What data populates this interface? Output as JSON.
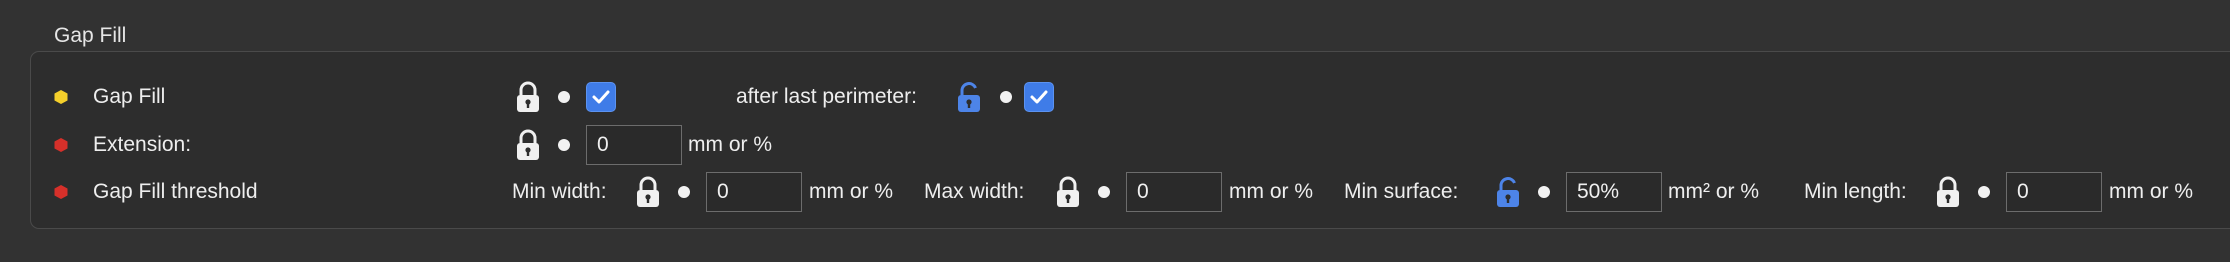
{
  "group": {
    "title": "Gap Fill"
  },
  "colors": {
    "yellow": "#f4cf2b",
    "red": "#d6302a",
    "accent": "#3f7ce8",
    "lock_unlocked": "#4d84e8",
    "lock_locked": "#f0f0f0"
  },
  "rows": [
    {
      "bullet_color": "yellow",
      "label": "Gap Fill",
      "lock": "locked",
      "checked": true,
      "extra_label": "after last perimeter:",
      "extra_lock": "unlocked",
      "extra_checked": true
    },
    {
      "bullet_color": "red",
      "label": "Extension:",
      "lock": "locked",
      "value": "0",
      "unit": "mm or %"
    },
    {
      "bullet_color": "red",
      "label": "Gap Fill threshold",
      "fields": [
        {
          "label": "Min width:",
          "lock": "locked",
          "value": "0",
          "unit": "mm or %"
        },
        {
          "label": "Max width:",
          "lock": "locked",
          "value": "0",
          "unit": "mm or %"
        },
        {
          "label": "Min surface:",
          "lock": "unlocked",
          "value": "50%",
          "unit": "mm² or %"
        },
        {
          "label": "Min length:",
          "lock": "locked",
          "value": "0",
          "unit": "mm or %"
        }
      ]
    }
  ]
}
